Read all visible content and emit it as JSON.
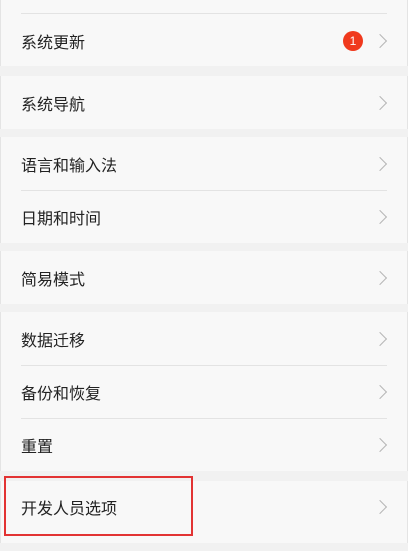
{
  "settings": {
    "system_update": {
      "label": "系统更新",
      "badge": "1"
    },
    "system_navigation": {
      "label": "系统导航"
    },
    "language_input": {
      "label": "语言和输入法"
    },
    "date_time": {
      "label": "日期和时间"
    },
    "simple_mode": {
      "label": "简易模式"
    },
    "data_migration": {
      "label": "数据迁移"
    },
    "backup_restore": {
      "label": "备份和恢复"
    },
    "reset": {
      "label": "重置"
    },
    "developer_options": {
      "label": "开发人员选项"
    }
  },
  "icons": {
    "chevron": "chevron-right-icon"
  },
  "colors": {
    "badge": "#f0391d",
    "highlight_box": "#e23333"
  }
}
